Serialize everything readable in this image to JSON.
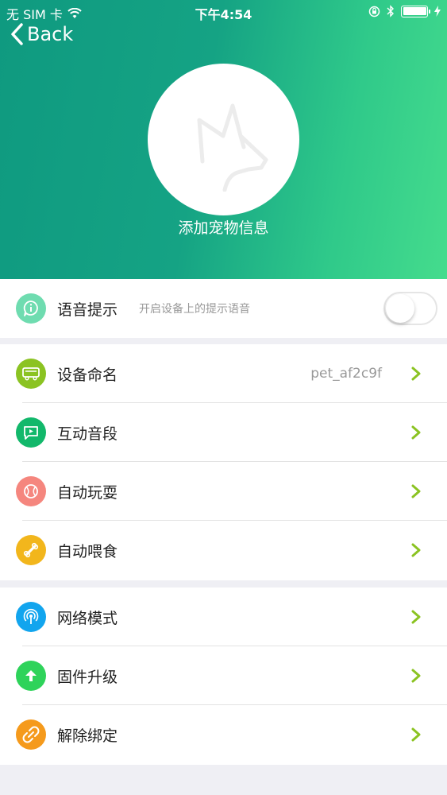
{
  "status_bar": {
    "carrier": "无 SIM 卡",
    "time": "下午4:54",
    "icons": [
      "wifi-icon",
      "orientation-lock-icon",
      "bluetooth-icon",
      "battery-icon",
      "charging-icon"
    ]
  },
  "nav": {
    "back_label": "Back"
  },
  "pet": {
    "caption": "添加宠物信息",
    "avatar_icon": "dog-icon"
  },
  "voice": {
    "label": "语音提示",
    "description": "开启设备上的提示语音",
    "toggle_on": false,
    "icon": "info-icon",
    "icon_color": "#6fdcb0"
  },
  "menu_group_1": [
    {
      "label": "设备命名",
      "value": "pet_af2c9f",
      "icon": "device-icon",
      "color": "#8bc322"
    },
    {
      "label": "互动音段",
      "value": "",
      "icon": "message-play-icon",
      "color": "#12b86b"
    },
    {
      "label": "自动玩耍",
      "value": "",
      "icon": "ball-icon",
      "color": "#f5867e"
    },
    {
      "label": "自动喂食",
      "value": "",
      "icon": "bone-icon",
      "color": "#f2b61c"
    }
  ],
  "menu_group_2": [
    {
      "label": "网络模式",
      "icon": "signal-icon",
      "color": "#12a5ee"
    },
    {
      "label": "固件升级",
      "icon": "upgrade-icon",
      "color": "#2ed35a"
    },
    {
      "label": "解除绑定",
      "icon": "unlink-icon",
      "color": "#f59a1c"
    }
  ],
  "colors": {
    "chevron": "#8bc322",
    "hero_start": "#0f9a80",
    "hero_end": "#45dc8d"
  }
}
